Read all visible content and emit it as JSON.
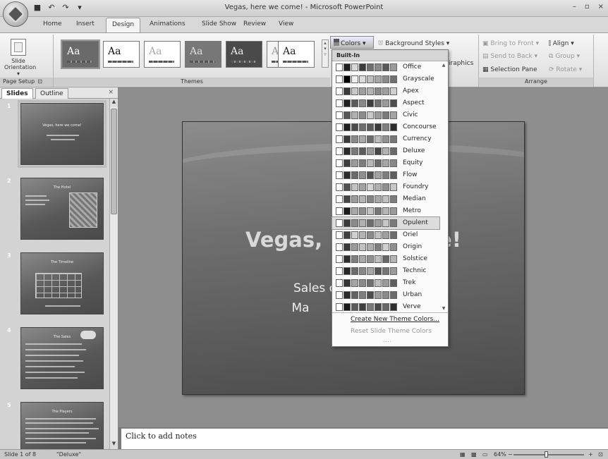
{
  "window": {
    "title": "Vegas, here we come! - Microsoft PowerPoint",
    "minimize": "–",
    "maximize": "▫",
    "close": "×"
  },
  "qat": {
    "save": "■",
    "undo": "↶",
    "redo": "↷",
    "more": "▾"
  },
  "tabs": [
    "Home",
    "Insert",
    "Design",
    "Animations",
    "Slide Show",
    "Review",
    "View"
  ],
  "active_tab": "Design",
  "ribbon": {
    "page_setup": {
      "button_line1": "Slide",
      "button_line2": "Orientation",
      "group_label": "Page Setup"
    },
    "themes": {
      "group_label": "Themes",
      "items": [
        {
          "label": "Aa",
          "bg": "#6a6a6a",
          "fg": "#ffffff"
        },
        {
          "label": "Aa",
          "bg": "#ffffff",
          "fg": "#111111"
        },
        {
          "label": "Aa",
          "bg": "#ffffff",
          "fg": "#aaaaaa"
        },
        {
          "label": "Aa",
          "bg": "#777777",
          "fg": "#dddddd"
        },
        {
          "label": "Aa",
          "bg": "#4a4a4a",
          "fg": "#eeeeee"
        },
        {
          "label": "Aa",
          "bg": "#f4f4f4",
          "fg": "#999999"
        },
        {
          "label": "Aa",
          "bg": "#ffffff",
          "fg": "#222222"
        }
      ]
    },
    "colors_button": "Colors",
    "background_styles": "Background Styles",
    "graphics_text": "iraphics",
    "arrange": {
      "group_label": "Arrange",
      "bring_to_front": "Bring to Front",
      "send_to_back": "Send to Back",
      "selection_pane": "Selection Pane",
      "align": "Align",
      "group": "Group",
      "rotate": "Rotate"
    }
  },
  "left_pane": {
    "tabs": [
      "Slides",
      "Outline"
    ],
    "close": "×",
    "slides": [
      {
        "num": "1",
        "title": "Vegas, here we come!"
      },
      {
        "num": "2",
        "title": "The Hotel"
      },
      {
        "num": "3",
        "title": "The Timeline"
      },
      {
        "num": "4",
        "title": "The Sales"
      },
      {
        "num": "5",
        "title": "The Players"
      }
    ]
  },
  "slide": {
    "title_left": "Vegas,",
    "title_right": "e!",
    "subtitle_line1": "Sales c",
    "subtitle_line2": "Ma"
  },
  "notes_placeholder": "Click to add notes",
  "status": {
    "slide_info": "Slide 1 of 8",
    "theme_name": "\"Deluxe\"",
    "zoom": "64%",
    "zoom_out": "−",
    "zoom_in": "+"
  },
  "colors_dropdown": {
    "header": "Built-In",
    "items": [
      {
        "name": "Office",
        "swatches": [
          "#ffffff",
          "#1f1f1f",
          "#d8d8d8",
          "#3c3c3c",
          "#6f6f6f",
          "#8a8a8a",
          "#5a5a5a",
          "#9a9a9a"
        ]
      },
      {
        "name": "Grayscale",
        "swatches": [
          "#ffffff",
          "#000000",
          "#f0f0f0",
          "#dcdcdc",
          "#c0c0c0",
          "#a8a8a8",
          "#8c8c8c",
          "#707070"
        ]
      },
      {
        "name": "Apex",
        "swatches": [
          "#ffffff",
          "#3a3a3a",
          "#c8c8c8",
          "#9e9e9e",
          "#b4b4b4",
          "#8a8a8a",
          "#a0a0a0",
          "#d0d0d0"
        ]
      },
      {
        "name": "Aspect",
        "swatches": [
          "#ffffff",
          "#202020",
          "#5a5a5a",
          "#888888",
          "#3e3e3e",
          "#707070",
          "#9a9a9a",
          "#4e4e4e"
        ]
      },
      {
        "name": "Civic",
        "swatches": [
          "#ffffff",
          "#555555",
          "#b0b0b0",
          "#8c8c8c",
          "#c8c8c8",
          "#9c9c9c",
          "#7a7a7a",
          "#a4a4a4"
        ]
      },
      {
        "name": "Concourse",
        "swatches": [
          "#ffffff",
          "#1e1e1e",
          "#4a4a4a",
          "#6e6e6e",
          "#5a5a5a",
          "#3a3a3a",
          "#808080",
          "#2c2c2c"
        ]
      },
      {
        "name": "Currency",
        "swatches": [
          "#ffffff",
          "#3a3a3a",
          "#8a8a8a",
          "#a8a8a8",
          "#6a6a6a",
          "#bcbcbc",
          "#929292",
          "#767676"
        ]
      },
      {
        "name": "Deluxe",
        "swatches": [
          "#ffffff",
          "#2a2a2a",
          "#7a7a7a",
          "#5c5c5c",
          "#989898",
          "#464646",
          "#b2b2b2",
          "#6a6a6a"
        ]
      },
      {
        "name": "Equity",
        "swatches": [
          "#ffffff",
          "#3c3c3c",
          "#9a9a9a",
          "#7c7c7c",
          "#b8b8b8",
          "#6c6c6c",
          "#a6a6a6",
          "#888888"
        ]
      },
      {
        "name": "Flow",
        "swatches": [
          "#ffffff",
          "#2c2c2c",
          "#6a6a6a",
          "#909090",
          "#525252",
          "#a4a4a4",
          "#7e7e7e",
          "#5e5e5e"
        ]
      },
      {
        "name": "Foundry",
        "swatches": [
          "#ffffff",
          "#505050",
          "#c2c2c2",
          "#a2a2a2",
          "#d4d4d4",
          "#b0b0b0",
          "#909090",
          "#c8c8c8"
        ]
      },
      {
        "name": "Median",
        "swatches": [
          "#ffffff",
          "#444444",
          "#9c9c9c",
          "#b4b4b4",
          "#848484",
          "#a8a8a8",
          "#c0c0c0",
          "#7c7c7c"
        ]
      },
      {
        "name": "Metro",
        "swatches": [
          "#ffffff",
          "#1c1c1c",
          "#a8a8a8",
          "#8e8e8e",
          "#c4c4c4",
          "#767676",
          "#b6b6b6",
          "#9a9a9a"
        ]
      },
      {
        "name": "Opulent",
        "swatches": [
          "#ffffff",
          "#3a3a3a",
          "#8a8a8a",
          "#b0b0b0",
          "#6e6e6e",
          "#9e9e9e",
          "#c6c6c6",
          "#7a7a7a"
        ]
      },
      {
        "name": "Oriel",
        "swatches": [
          "#ffffff",
          "#404040",
          "#d0d0d0",
          "#b4b4b4",
          "#8a8a8a",
          "#c2c2c2",
          "#a0a0a0",
          "#6c6c6c"
        ]
      },
      {
        "name": "Origin",
        "swatches": [
          "#ffffff",
          "#383838",
          "#9a9a9a",
          "#c2c2c2",
          "#acacac",
          "#7e7e7e",
          "#d0d0d0",
          "#8e8e8e"
        ]
      },
      {
        "name": "Solstice",
        "swatches": [
          "#ffffff",
          "#2e2e2e",
          "#7e7e7e",
          "#a8a8a8",
          "#929292",
          "#bebebe",
          "#666666",
          "#b4b4b4"
        ]
      },
      {
        "name": "Technic",
        "swatches": [
          "#ffffff",
          "#262626",
          "#6a6a6a",
          "#888888",
          "#a6a6a6",
          "#545454",
          "#767676",
          "#9a9a9a"
        ]
      },
      {
        "name": "Trek",
        "swatches": [
          "#ffffff",
          "#343434",
          "#a4a4a4",
          "#8a8a8a",
          "#6e6e6e",
          "#bcbcbc",
          "#9a9a9a",
          "#5e5e5e"
        ]
      },
      {
        "name": "Urban",
        "swatches": [
          "#ffffff",
          "#2a2a2a",
          "#626262",
          "#7e7e7e",
          "#4c4c4c",
          "#9c9c9c",
          "#8a8a8a",
          "#6c6c6c"
        ]
      },
      {
        "name": "Verve",
        "swatches": [
          "#ffffff",
          "#1a1a1a",
          "#5a5a5a",
          "#3e3e3e",
          "#7a7a7a",
          "#4a4a4a",
          "#686868",
          "#2e2e2e"
        ]
      }
    ],
    "highlighted_item": "Opulent",
    "create_new": "Create New Theme Colors...",
    "reset": "Reset Slide Theme Colors"
  }
}
